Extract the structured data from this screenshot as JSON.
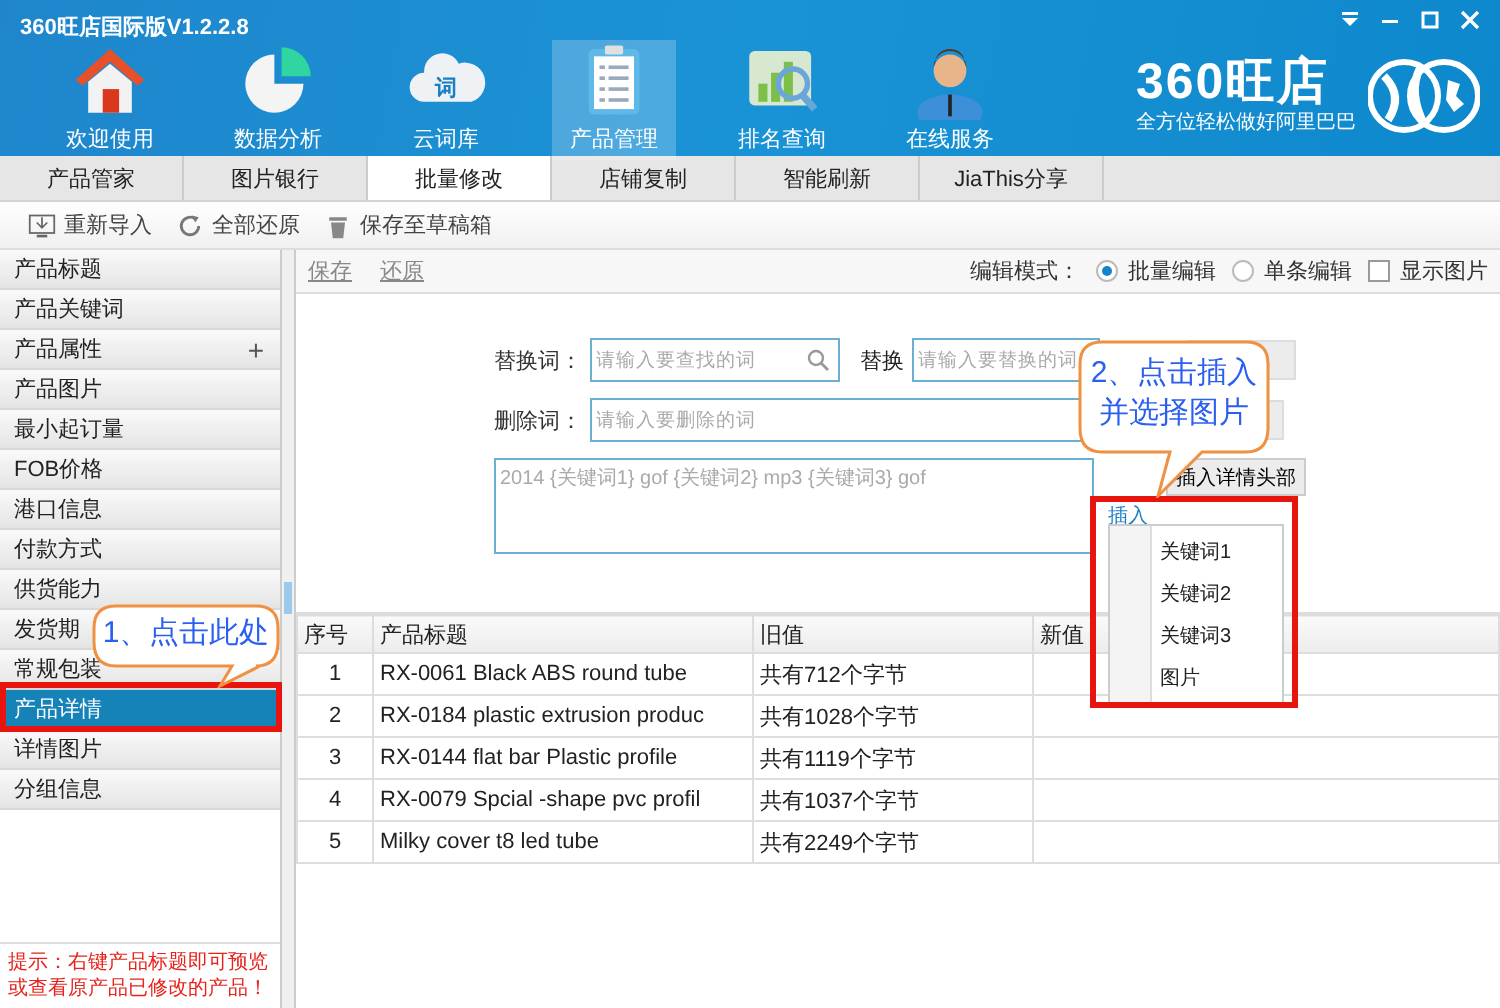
{
  "window": {
    "title": "360旺店国际版V1.2.2.8",
    "brand": "360旺店",
    "slogan": "全方位轻松做好阿里巴巴"
  },
  "nav": [
    {
      "label": "欢迎使用",
      "selected": false
    },
    {
      "label": "数据分析",
      "selected": false
    },
    {
      "label": "云词库",
      "icon_text": "词",
      "selected": false
    },
    {
      "label": "产品管理",
      "selected": true
    },
    {
      "label": "排名查询",
      "selected": false
    },
    {
      "label": "在线服务",
      "selected": false
    }
  ],
  "subtabs": [
    {
      "label": "产品管家",
      "selected": false
    },
    {
      "label": "图片银行",
      "selected": false
    },
    {
      "label": "批量修改",
      "selected": true
    },
    {
      "label": "店铺复制",
      "selected": false
    },
    {
      "label": "智能刷新",
      "selected": false
    },
    {
      "label": "JiaThis分享",
      "selected": false
    }
  ],
  "toolbar": [
    {
      "label": "重新导入"
    },
    {
      "label": "全部还原"
    },
    {
      "label": "保存至草稿箱"
    }
  ],
  "sidebar": {
    "items": [
      {
        "label": "产品标题",
        "selected": false
      },
      {
        "label": "产品关键词",
        "selected": false
      },
      {
        "label": "产品属性",
        "selected": false,
        "toggle": "+"
      },
      {
        "label": "产品图片",
        "selected": false
      },
      {
        "label": "最小起订量",
        "selected": false
      },
      {
        "label": "FOB价格",
        "selected": false
      },
      {
        "label": "港口信息",
        "selected": false
      },
      {
        "label": "付款方式",
        "selected": false
      },
      {
        "label": "供货能力",
        "selected": false
      },
      {
        "label": "发货期",
        "selected": false
      },
      {
        "label": "常规包装",
        "selected": false
      },
      {
        "label": "产品详情",
        "selected": true
      },
      {
        "label": "详情图片",
        "selected": false
      },
      {
        "label": "分组信息",
        "selected": false
      }
    ],
    "hint": "提示：右键产品标题即可预览或查看原产品已修改的产品！"
  },
  "editor": {
    "links": [
      "保存",
      "还原"
    ],
    "mode_label": "编辑模式：",
    "modes": [
      {
        "label": "批量编辑",
        "selected": true
      },
      {
        "label": "单条编辑",
        "selected": false
      }
    ],
    "show_images": {
      "label": "显示图片",
      "checked": false
    },
    "replace": {
      "label": "替换词：",
      "placeholder": "请输入要查找的词"
    },
    "replace_with": {
      "label": "替换",
      "placeholder": "请输入要替换的词"
    },
    "delete": {
      "label": "删除词：",
      "placeholder": "请输入要删除的词"
    },
    "template": {
      "placeholder": "2014 {关键词1} gof {关键词2} mp3 {关键词3} gof"
    },
    "insert_head_button": "插入详情头部",
    "insert_menu": {
      "label": "插入",
      "items": [
        "关键词1",
        "关键词2",
        "关键词3",
        "图片"
      ]
    }
  },
  "table": {
    "columns": [
      "序号",
      "产品标题",
      "旧值",
      "新值"
    ],
    "rows": [
      {
        "index": "1",
        "title": "RX-0061 Black ABS round tube",
        "old_value": "共有712个字节"
      },
      {
        "index": "2",
        "title": "RX-0184 plastic extrusion produc",
        "old_value": "共有1028个字节"
      },
      {
        "index": "3",
        "title": "RX-0144 flat bar Plastic profile",
        "old_value": "共有1119个字节"
      },
      {
        "index": "4",
        "title": "RX-0079 Spcial -shape pvc profil",
        "old_value": "共有1037个字节"
      },
      {
        "index": "5",
        "title": "Milky cover t8 led tube",
        "old_value": "共有2249个字节"
      }
    ]
  },
  "annotations": [
    {
      "lines": [
        "1、点击此处"
      ]
    },
    {
      "lines": [
        "2、点击插入",
        "并选择图片"
      ]
    }
  ]
}
